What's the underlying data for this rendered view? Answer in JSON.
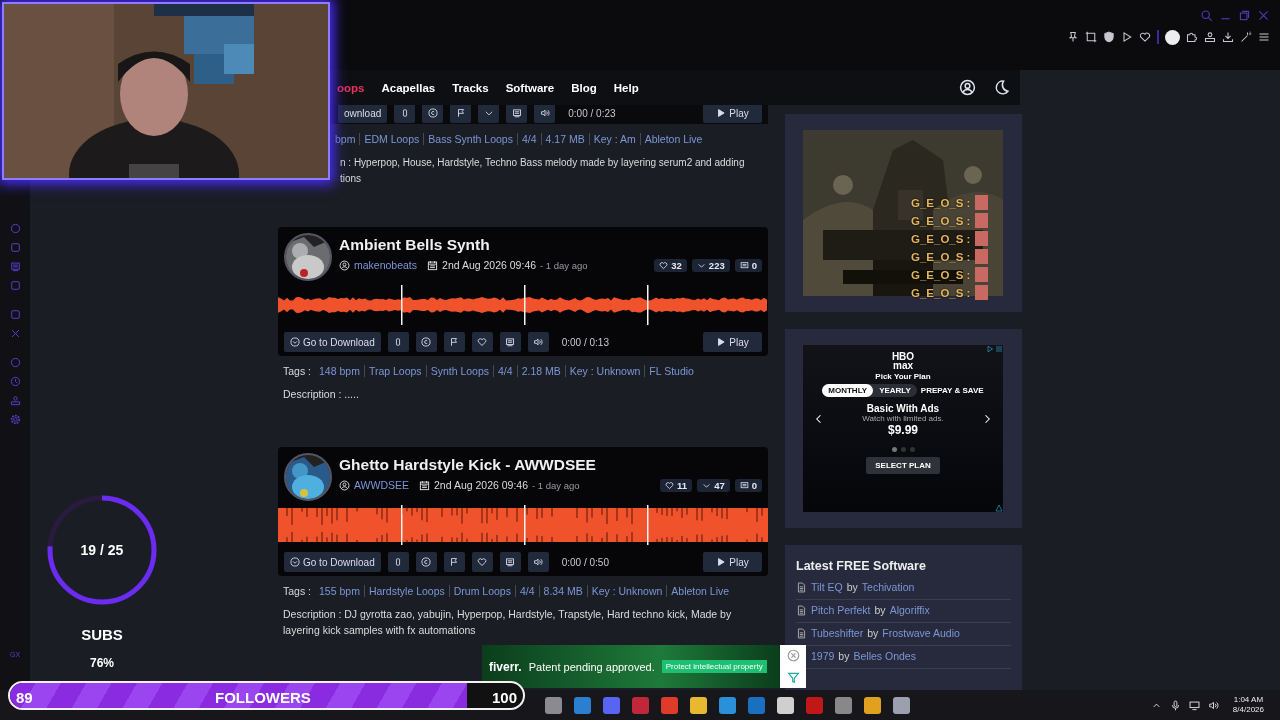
{
  "site_nav": {
    "items": [
      {
        "label": "oops",
        "selected": true
      },
      {
        "label": "Acapellas",
        "selected": false
      },
      {
        "label": "Tracks",
        "selected": false
      },
      {
        "label": "Software",
        "selected": false
      },
      {
        "label": "Blog",
        "selected": false
      },
      {
        "label": "Help",
        "selected": false
      }
    ]
  },
  "partial_track": {
    "download": "ownload",
    "time": "0:00 / 0:23",
    "play": "Play",
    "tags": [
      "bpm",
      "EDM Loops",
      "Bass Synth Loops",
      "4/4",
      "4.17 MB",
      "Key : Am",
      "Ableton Live"
    ],
    "description_lines": [
      "n : Hyperpop, House, Hardstyle, Techno Bass melody made by layering serum2 and adding",
      "tions"
    ]
  },
  "tracks": [
    {
      "title": "Ambient Bells Synth",
      "author": "makenobeats",
      "date": "2nd Aug 2026 09:46",
      "ago": "- 1 day ago",
      "likes": "32",
      "downloads": "223",
      "comments": "0",
      "kind": "soft",
      "download": "Go to Download",
      "time": "0:00 / 0:13",
      "play": "Play",
      "tags_label": "Tags :",
      "tags": [
        "148 bpm",
        "Trap Loops",
        "Synth Loops",
        "4/4",
        "2.18 MB",
        "Key : Unknown",
        "FL Studio"
      ],
      "description": "Description : ....."
    },
    {
      "title": "Ghetto Hardstyle Kick - AWWDSEE",
      "author": "AWWDSEE",
      "date": "2nd Aug 2026 09:46",
      "ago": "- 1 day ago",
      "likes": "11",
      "downloads": "47",
      "comments": "0",
      "kind": "loud",
      "download": "Go to Download",
      "time": "0:00 / 0:50",
      "play": "Play",
      "tags_label": "Tags :",
      "tags": [
        "155 bpm",
        "Hardstyle Loops",
        "Drum Loops",
        "4/4",
        "8.34 MB",
        "Key : Unknown",
        "Ableton Live"
      ],
      "description": "Description : DJ gyrotta zao, yabujin, Hyperpop, Hardstyle, Trapstyle, Hard techno kick, Made by layering kick samples with fx automations"
    }
  ],
  "sidebar": {
    "plan_ad": {
      "logo_top": "HBO",
      "logo_bottom": "max",
      "heading": "Pick Your Plan",
      "options": [
        {
          "label": "MONTHLY",
          "selected": true
        },
        {
          "label": "YEARLY",
          "selected": false
        }
      ],
      "extra": "PREPAY & SAVE",
      "plan": "Basic With Ads",
      "subtitle": "Watch with limited ads.",
      "price": "$9.99",
      "dots": [
        {
          "selected": true
        },
        {
          "selected": false
        },
        {
          "selected": false
        }
      ],
      "cta": "SELECT PLAN"
    },
    "software": {
      "title": "Latest FREE Software",
      "items": [
        {
          "name": "Tilt EQ",
          "by": "by",
          "maker": "Techivation"
        },
        {
          "name": "Pitch Perfekt",
          "by": "by",
          "maker": "Algoriffix"
        },
        {
          "name": "Tubeshifter",
          "by": "by",
          "maker": "Frostwave Audio"
        },
        {
          "name": "1979",
          "by": "by",
          "maker": "Belles Ondes"
        }
      ]
    }
  },
  "browser_sidebar": {
    "label": "GX"
  },
  "stream_overlay": {
    "subs": {
      "count": "19 / 25",
      "label": "SUBS",
      "percent": "76%",
      "level": 0.76
    },
    "followers": {
      "current": "89",
      "label": "FOLLOWERS",
      "goal": "100",
      "level": 0.89
    },
    "chat": [
      {
        "name": "G_E_O_S :"
      },
      {
        "name": "G_E_O_S :"
      },
      {
        "name": "G_E_O_S :"
      },
      {
        "name": "G_E_O_S :"
      },
      {
        "name": "G_E_O_S :"
      },
      {
        "name": "G_E_O_S :"
      }
    ]
  },
  "fiverr_ad": {
    "brand": "fiverr.",
    "message": "Patent pending approved.",
    "cta": "Protect intellectual property"
  },
  "taskbar": {
    "time": "1:04 AM",
    "date": "8/4/2026"
  }
}
